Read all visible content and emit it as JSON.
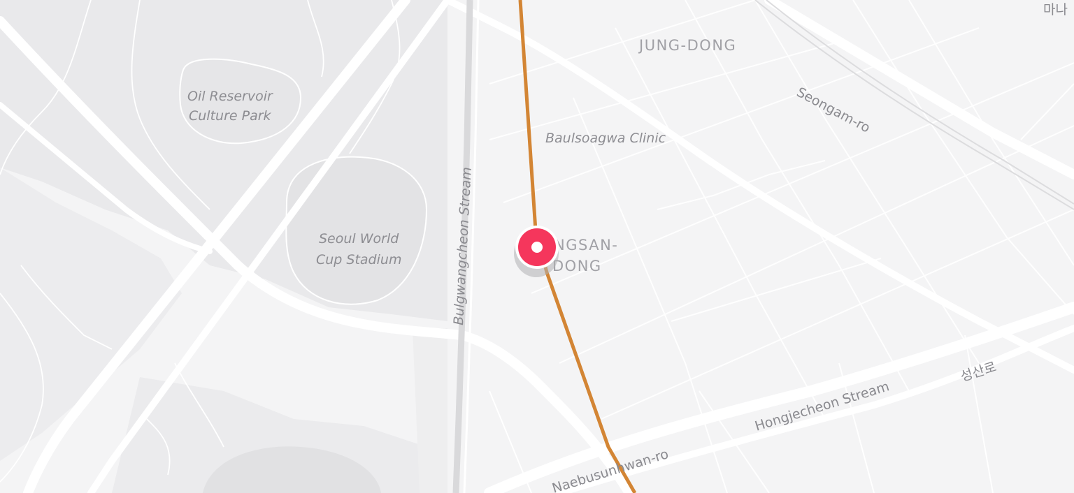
{
  "map": {
    "colors": {
      "background": "#f4f4f5",
      "park": "#e9e9eb",
      "water": "#e0e0e2",
      "road": "#ffffff",
      "route": "#d38534",
      "marker": "#f5365c"
    },
    "labels": {
      "area_jungdong": "JUNG-DONG",
      "area_seongsan_line1": "NGSAN-",
      "area_seongsan_line2": "DONG",
      "road_seongam": "Seongam-ro",
      "road_bulgwangcheon": "Bulgwangcheon Stream",
      "road_hongjecheon": "Hongjecheon Stream",
      "road_seongsan_kr": "성산로",
      "road_naebusunhwan": "Naebusunhwan-ro",
      "corner_kr": "마나",
      "poi_oil_line1": "Oil Reservoir",
      "poi_oil_line2": "Culture Park",
      "poi_stadium_line1": "Seoul World",
      "poi_stadium_line2": "Cup Stadium",
      "poi_clinic": "Baulsoagwa Clinic"
    },
    "marker": {
      "icon": "location-pin-icon"
    }
  }
}
